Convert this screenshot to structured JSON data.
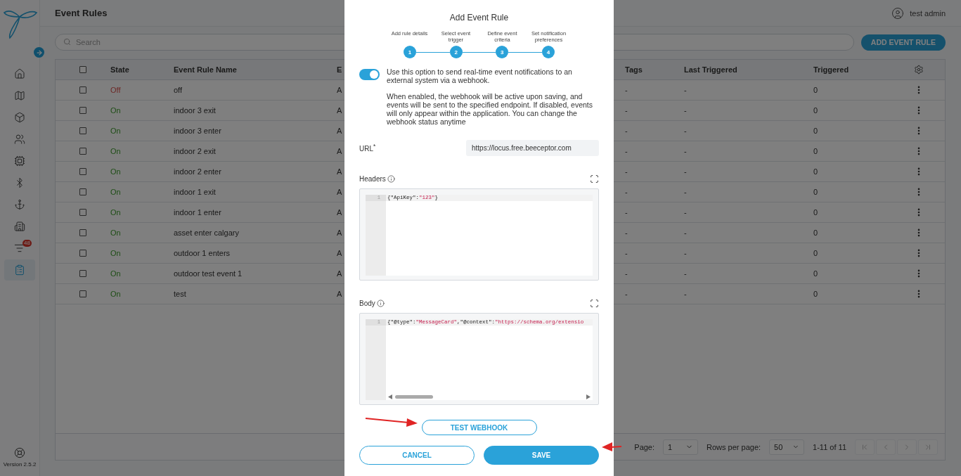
{
  "sidebar": {
    "items": [
      {
        "selected": false
      },
      {
        "selected": false
      },
      {
        "selected": false
      },
      {
        "selected": false
      },
      {
        "selected": false
      },
      {
        "selected": false
      },
      {
        "selected": false
      },
      {
        "selected": false
      },
      {
        "selected": false,
        "badge": "48"
      },
      {
        "selected": true
      }
    ],
    "version": "Version 2.5.2"
  },
  "header": {
    "title": "Event Rules",
    "user": "test admin"
  },
  "search": {
    "placeholder": "Search"
  },
  "add_button": "ADD EVENT RULE",
  "table": {
    "columns": [
      "State",
      "Event Rule Name",
      "E",
      "Tags",
      "Last Triggered",
      "Triggered"
    ],
    "header_checked": false,
    "rows": [
      {
        "checked": false,
        "on": false,
        "state": "Off",
        "name": "off",
        "column_4": "A",
        "tags": "-",
        "last_triggered": "-",
        "triggered": "0"
      },
      {
        "checked": false,
        "on": true,
        "state": "On",
        "name": "indoor 3 exit",
        "column_4": "A",
        "tags": "-",
        "last_triggered": "-",
        "triggered": "0"
      },
      {
        "checked": false,
        "on": true,
        "state": "On",
        "name": "indoor 3 enter",
        "column_4": "A",
        "tags": "-",
        "last_triggered": "-",
        "triggered": "0"
      },
      {
        "checked": false,
        "on": true,
        "state": "On",
        "name": "indoor 2 exit",
        "column_4": "A",
        "tags": "-",
        "last_triggered": "-",
        "triggered": "0"
      },
      {
        "checked": false,
        "on": true,
        "state": "On",
        "name": "indoor 2 enter",
        "column_4": "A",
        "tags": "-",
        "last_triggered": "-",
        "triggered": "0"
      },
      {
        "checked": false,
        "on": true,
        "state": "On",
        "name": "indoor 1 exit",
        "column_4": "A",
        "tags": "-",
        "last_triggered": "-",
        "triggered": "0"
      },
      {
        "checked": false,
        "on": true,
        "state": "On",
        "name": "indoor 1 enter",
        "column_4": "A",
        "tags": "-",
        "last_triggered": "-",
        "triggered": "0"
      },
      {
        "checked": false,
        "on": true,
        "state": "On",
        "name": "asset enter calgary",
        "column_4": "A",
        "tags": "-",
        "last_triggered": "-",
        "triggered": "0"
      },
      {
        "checked": false,
        "on": true,
        "state": "On",
        "name": "outdoor 1 enters",
        "column_4": "A",
        "tags": "-",
        "last_triggered": "-",
        "triggered": "0"
      },
      {
        "checked": false,
        "on": true,
        "state": "On",
        "name": "outdoor test event 1",
        "column_4": "A",
        "tags": "-",
        "last_triggered": "-",
        "triggered": "0"
      },
      {
        "checked": false,
        "on": true,
        "state": "On",
        "name": "test",
        "column_4": "A",
        "tags": "-",
        "last_triggered": "-",
        "triggered": "0"
      }
    ]
  },
  "pagination": {
    "page_label": "Page:",
    "page": "1",
    "rows_label": "Rows per page:",
    "rows": "50",
    "range": "1-11 of 11",
    "nav": [
      {
        "disabled": true
      },
      {
        "disabled": true
      },
      {
        "disabled": true
      },
      {
        "disabled": true
      }
    ]
  },
  "modal": {
    "title": "Add Event Rule",
    "steps": [
      {
        "label": "Add rule details",
        "number": "1"
      },
      {
        "label": "Select event trigger",
        "number": "2"
      },
      {
        "label": "Define event criteria",
        "number": "3"
      },
      {
        "label": "Set notification preferences",
        "number": "4"
      }
    ],
    "webhook": {
      "enabled": true,
      "text": "Use this option to send real-time event notifications to an external system via a webhook.",
      "note": "When enabled, the webhook will be active upon saving, and events will be sent to the specified endpoint. If disabled, events will only appear within the application. You can change the webhook status anytime"
    },
    "url": {
      "label": "URL$^{*}$",
      "value": "https://locus.free.beeceptor.com"
    },
    "editors": [
      {
        "label": "Headers",
        "line_number": "1",
        "code": "{\"ApiKey\":\"123\"}",
        "scrollbar": false
      },
      {
        "label": "Body",
        "line_number": "1",
        "code": "{\"@type\":\"MessageCard\",\"@context\":\"https://schema.org/extensio",
        "scrollbar": true
      }
    ],
    "test_button": "TEST WEBHOOK",
    "cancel_button": "CANCEL",
    "save_button": "SAVE"
  }
}
